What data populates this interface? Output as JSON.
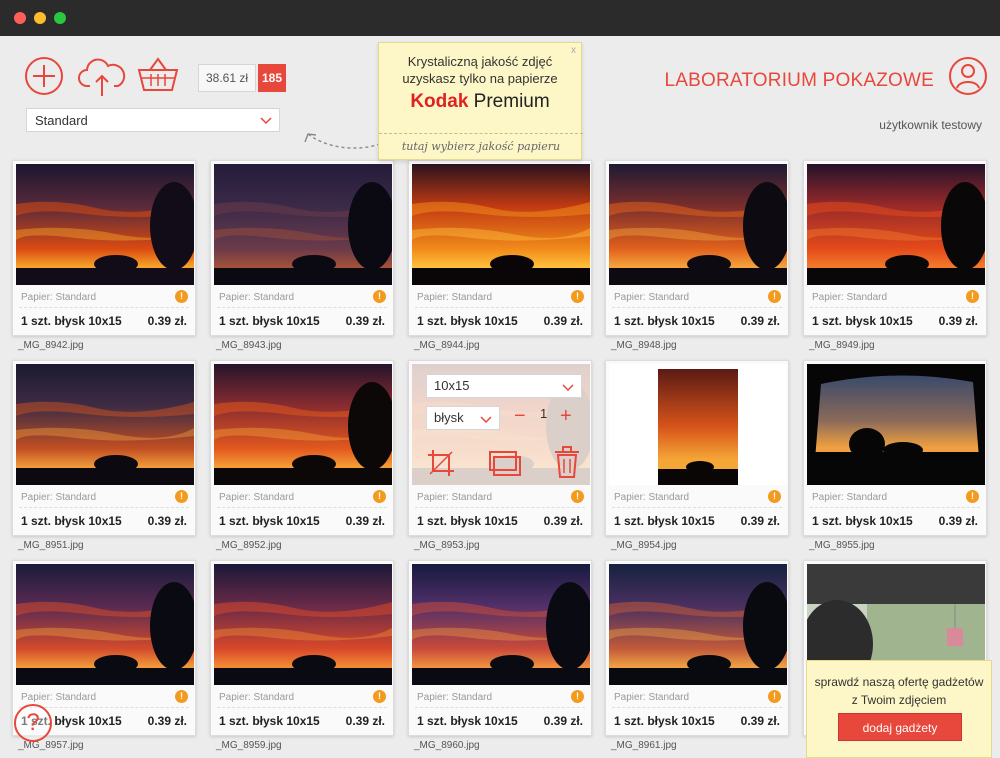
{
  "window": {
    "controls": [
      "close",
      "minimize",
      "maximize"
    ],
    "colors": {
      "close": "#ff5f57",
      "minimize": "#febc2e",
      "maximize": "#28c840"
    }
  },
  "header": {
    "price": "38.61 zł",
    "photo_count": "185",
    "quality_select": "Standard",
    "lab_name": "LABORATORIUM POKAZOWE",
    "user_name": "użytkownik testowy",
    "icons": [
      "add-icon",
      "upload-cloud-icon",
      "basket-icon",
      "user-icon"
    ],
    "accent_color": "#e8473b"
  },
  "promo": {
    "line1": "Krystaliczną jakość zdjęć",
    "line2": "uzyskasz tylko na papierze",
    "brand_main": "Kodak",
    "brand_sub": "Premium",
    "hint": "tutaj wybierz jakość papieru",
    "close": "x"
  },
  "photos": [
    {
      "paper": "Papier: Standard",
      "desc": "1 szt. błysk 10x15",
      "price": "0.39 zł.",
      "file": "_MG_8942.jpg"
    },
    {
      "paper": "Papier: Standard",
      "desc": "1 szt. błysk 10x15",
      "price": "0.39 zł.",
      "file": "_MG_8943.jpg"
    },
    {
      "paper": "Papier: Standard",
      "desc": "1 szt. błysk 10x15",
      "price": "0.39 zł.",
      "file": "_MG_8944.jpg"
    },
    {
      "paper": "Papier: Standard",
      "desc": "1 szt. błysk 10x15",
      "price": "0.39 zł.",
      "file": "_MG_8948.jpg"
    },
    {
      "paper": "Papier: Standard",
      "desc": "1 szt. błysk 10x15",
      "price": "0.39 zł.",
      "file": "_MG_8949.jpg"
    },
    {
      "paper": "Papier: Standard",
      "desc": "1 szt. błysk 10x15",
      "price": "0.39 zł.",
      "file": "_MG_8951.jpg"
    },
    {
      "paper": "Papier: Standard",
      "desc": "1 szt. błysk 10x15",
      "price": "0.39 zł.",
      "file": "_MG_8952.jpg"
    },
    {
      "paper": "Papier: Standard",
      "desc": "1 szt. błysk 10x15",
      "price": "0.39 zł.",
      "file": "_MG_8953.jpg"
    },
    {
      "paper": "Papier: Standard",
      "desc": "1 szt. błysk 10x15",
      "price": "0.39 zł.",
      "file": "_MG_8954.jpg"
    },
    {
      "paper": "Papier: Standard",
      "desc": "1 szt. błysk 10x15",
      "price": "0.39 zł.",
      "file": "_MG_8955.jpg"
    },
    {
      "paper": "Papier: Standard",
      "desc": "1 szt. błysk 10x15",
      "price": "0.39 zł.",
      "file": "_MG_8957.jpg"
    },
    {
      "paper": "Papier: Standard",
      "desc": "1 szt. błysk 10x15",
      "price": "0.39 zł.",
      "file": "_MG_8959.jpg"
    },
    {
      "paper": "Papier: Standard",
      "desc": "1 szt. błysk 10x15",
      "price": "0.39 zł.",
      "file": "_MG_8960.jpg"
    },
    {
      "paper": "Papier: Standard",
      "desc": "1 szt. błysk 10x15",
      "price": "0.39 zł.",
      "file": "_MG_8961.jpg"
    }
  ],
  "editor": {
    "size": "10x15",
    "finish": "błysk",
    "quantity": "1",
    "minus": "−",
    "plus": "+",
    "icons": [
      "crop-icon",
      "copy-icon",
      "trash-icon"
    ]
  },
  "gadget": {
    "line1": "sprawdź naszą ofertę gadżetów",
    "line2": "z Twoim zdjęciem",
    "button": "dodaj gadżety"
  },
  "help": {
    "label": "?"
  }
}
